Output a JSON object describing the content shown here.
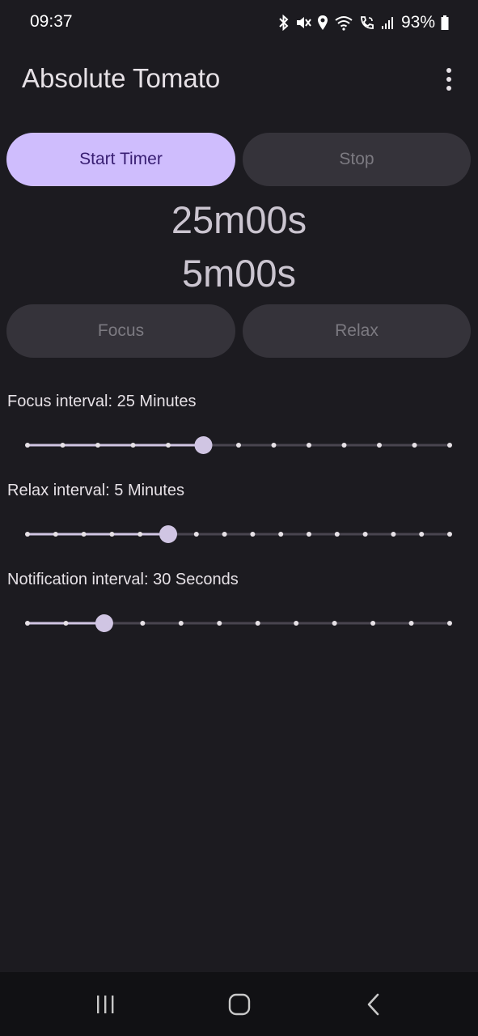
{
  "status_bar": {
    "time": "09:37",
    "battery": "93%",
    "icons": [
      "bluetooth-icon",
      "mute-icon",
      "location-icon",
      "wifi-icon",
      "wifi-calling-icon",
      "signal-icon",
      "battery-icon"
    ]
  },
  "app_bar": {
    "title": "Absolute Tomato",
    "menu_icon": "more-vert-icon"
  },
  "controls": {
    "start_label": "Start Timer",
    "stop_label": "Stop",
    "focus_label": "Focus",
    "relax_label": "Relax"
  },
  "timers": {
    "focus": "25m00s",
    "relax": "5m00s"
  },
  "sliders": [
    {
      "label": "Focus interval: 25 Minutes",
      "steps": 13,
      "value_index": 5
    },
    {
      "label": "Relax interval: 5 Minutes",
      "steps": 16,
      "value_index": 5
    },
    {
      "label": "Notification interval: 30 Seconds",
      "steps": 12,
      "value_index": 2
    }
  ],
  "colors": {
    "background": "#1c1b20",
    "primary": "#cfbdfd",
    "on_primary": "#381e72",
    "disabled_container": "#35333a",
    "slider_active": "#d0c5e3",
    "slider_inactive": "#49454f"
  },
  "nav_bar": {
    "icons": [
      "recents-icon",
      "home-icon",
      "back-icon"
    ]
  }
}
